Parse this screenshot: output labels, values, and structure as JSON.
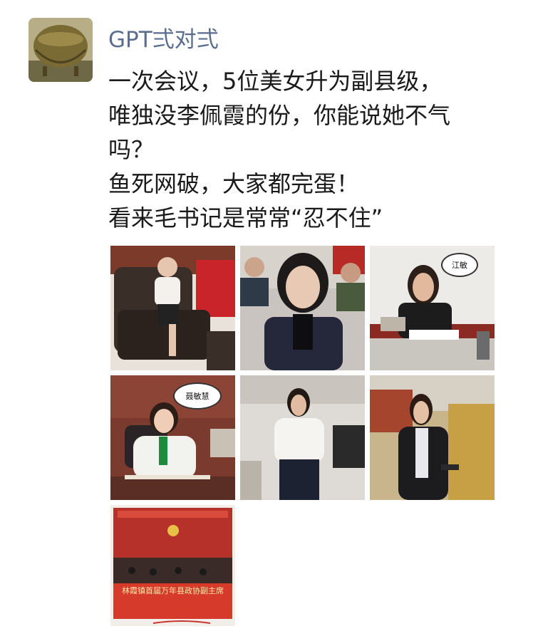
{
  "post": {
    "author": "GPT弍对弍",
    "lines": [
      "一次会议，5位美女升为副县级，",
      "唯独没李佩霞的份，你能说她不气",
      "吗？",
      "鱼死网破，大家都完蛋！",
      "看来毛书记是常常“忍不住”"
    ]
  },
  "images": {
    "img3_bubble": "江敏",
    "img4_bubble": "聂敏慧",
    "img7_banner": "林霞镇首届万年县政协副主席"
  }
}
